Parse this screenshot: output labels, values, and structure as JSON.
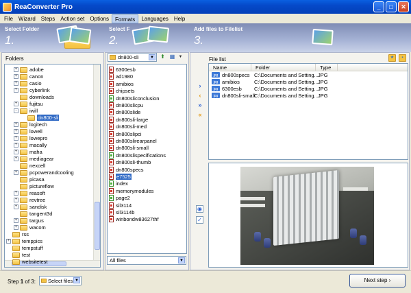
{
  "window": {
    "title": "ReaConverter Pro",
    "minimize": "_",
    "maximize": "□",
    "close": "✕"
  },
  "menu": [
    "File",
    "Wizard",
    "Steps",
    "Action set",
    "Options",
    "Formats",
    "Languages",
    "Help"
  ],
  "menu_active": "Formats",
  "steps": [
    {
      "title": "Select Folder",
      "number": "1."
    },
    {
      "title": "Select F",
      "number": "2."
    },
    {
      "title": "Add files to Filelist",
      "number": "3."
    }
  ],
  "folders_panel": {
    "label": "Folders"
  },
  "folder_tree": [
    {
      "label": "adobe",
      "indent": 1,
      "expander": "+"
    },
    {
      "label": "canon",
      "indent": 1,
      "expander": "+"
    },
    {
      "label": "casio",
      "indent": 1,
      "expander": "+"
    },
    {
      "label": "cyberlink",
      "indent": 1,
      "expander": "+"
    },
    {
      "label": "downloads",
      "indent": 1,
      "expander": ""
    },
    {
      "label": "fujitsu",
      "indent": 1,
      "expander": "+"
    },
    {
      "label": "iwill",
      "indent": 1,
      "expander": "-"
    },
    {
      "label": "dn800-sli",
      "indent": 2,
      "expander": "",
      "selected": true
    },
    {
      "label": "logitech",
      "indent": 1,
      "expander": "+"
    },
    {
      "label": "lowell",
      "indent": 1,
      "expander": "+"
    },
    {
      "label": "lowepro",
      "indent": 1,
      "expander": "+"
    },
    {
      "label": "macally",
      "indent": 1,
      "expander": "+"
    },
    {
      "label": "maha",
      "indent": 1,
      "expander": "+"
    },
    {
      "label": "mediagear",
      "indent": 1,
      "expander": "+"
    },
    {
      "label": "nexcell",
      "indent": 1,
      "expander": ""
    },
    {
      "label": "pcpowerandcooling",
      "indent": 1,
      "expander": "+"
    },
    {
      "label": "picasa",
      "indent": 1,
      "expander": ""
    },
    {
      "label": "pictureflow",
      "indent": 1,
      "expander": ""
    },
    {
      "label": "reasoft",
      "indent": 1,
      "expander": "+"
    },
    {
      "label": "revtree",
      "indent": 1,
      "expander": "+"
    },
    {
      "label": "sandisk",
      "indent": 1,
      "expander": "+"
    },
    {
      "label": "tangent3d",
      "indent": 1,
      "expander": ""
    },
    {
      "label": "targus",
      "indent": 1,
      "expander": "+"
    },
    {
      "label": "wacom",
      "indent": 1,
      "expander": "+"
    },
    {
      "label": "rss",
      "indent": 0,
      "expander": ""
    },
    {
      "label": "temppics",
      "indent": 0,
      "expander": "+"
    },
    {
      "label": "tempstuff",
      "indent": 0,
      "expander": ""
    },
    {
      "label": "test",
      "indent": 0,
      "expander": ""
    },
    {
      "label": "websitetest",
      "indent": 0,
      "expander": ""
    }
  ],
  "files_panel": {
    "folder_combo": "dn800-sli",
    "filter": "All files",
    "files": [
      {
        "name": "6300esb",
        "icon": "red"
      },
      {
        "name": "ad1980",
        "icon": "red"
      },
      {
        "name": "amibios",
        "icon": "red"
      },
      {
        "name": "chipsets",
        "icon": "red"
      },
      {
        "name": "dn800sliconclusion",
        "icon": "green"
      },
      {
        "name": "dn800slicpu",
        "icon": "red"
      },
      {
        "name": "dn800slide",
        "icon": "red"
      },
      {
        "name": "dn800sli-large",
        "icon": "red"
      },
      {
        "name": "dn800sli-med",
        "icon": "red"
      },
      {
        "name": "dn800slipci",
        "icon": "red"
      },
      {
        "name": "dn800slirearpanel",
        "icon": "red"
      },
      {
        "name": "dn800sli-small",
        "icon": "red"
      },
      {
        "name": "dn800slispecifications",
        "icon": "green"
      },
      {
        "name": "dn800sli-thumb",
        "icon": "red"
      },
      {
        "name": "dn800specs",
        "icon": "red"
      },
      {
        "name": "e7525",
        "icon": "red",
        "selected": true
      },
      {
        "name": "index",
        "icon": "green"
      },
      {
        "name": "memorymodules",
        "icon": "red"
      },
      {
        "name": "page2",
        "icon": "green"
      },
      {
        "name": "sil3114",
        "icon": "red"
      },
      {
        "name": "sil3114b",
        "icon": "red"
      },
      {
        "name": "winbondw83627thf",
        "icon": "red"
      }
    ]
  },
  "filelist": {
    "label": "File list",
    "columns": [
      "Name",
      "Folder",
      "Type"
    ],
    "rows": [
      {
        "name": "dn800specs",
        "folder": "C:\\Documents and Setting...",
        "type": "JPG"
      },
      {
        "name": "amibios",
        "folder": "C:\\Documents and Setting...",
        "type": "JPG"
      },
      {
        "name": "6300esb",
        "folder": "C:\\Documents and Setting...",
        "type": "JPG"
      },
      {
        "name": "dn800sli-small",
        "folder": "C:\\Documents and Setting...",
        "type": "JPG"
      }
    ],
    "icon_text": "jpg"
  },
  "arrows": [
    {
      "glyph": "›",
      "kind": "add"
    },
    {
      "glyph": "‹",
      "kind": "remove"
    },
    {
      "glyph": "»",
      "kind": "add"
    },
    {
      "glyph": "«",
      "kind": "remove"
    }
  ],
  "bottom": {
    "step_prefix": "Step",
    "step_current": "1",
    "step_of": "of",
    "step_total": "3:",
    "step_combo": "Select files",
    "next_button": "Next step ›"
  },
  "colors": {
    "selection": "#316ac5",
    "title_bar": "#0549c9",
    "add_arrow": "#2a5fd0",
    "remove_arrow": "#e29a17"
  }
}
